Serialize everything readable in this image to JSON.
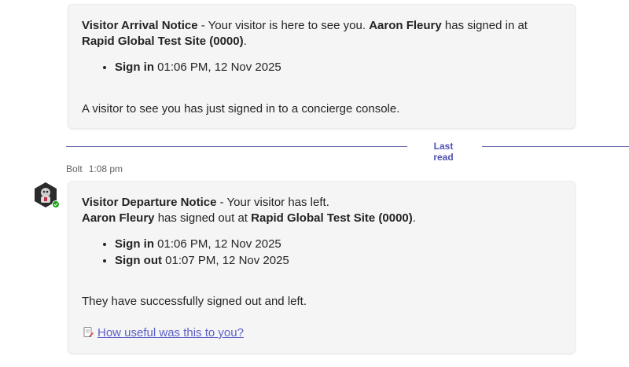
{
  "messages": [
    {
      "heading": "Visitor Arrival Notice",
      "sep": " - ",
      "intro": "Your visitor is here to see you.",
      "visitor": "Aaron Fleury",
      "action_text": "has signed in at",
      "site": "Rapid Global Test Site (0000)",
      "period": ".",
      "items": [
        {
          "label": "Sign in",
          "value": "01:06 PM, 12 Nov 2025"
        }
      ],
      "footer": "A visitor to see you has just signed in to a concierge console."
    },
    {
      "sender": "Bolt",
      "time": "1:08 pm",
      "heading": "Visitor Departure Notice",
      "sep": " - ",
      "intro": "Your visitor has left.",
      "visitor": "Aaron Fleury",
      "action_text": "has signed out at",
      "site": "Rapid Global Test Site (0000)",
      "period": ".",
      "items": [
        {
          "label": "Sign in",
          "value": "01:06 PM, 12 Nov 2025"
        },
        {
          "label": "Sign out",
          "value": "01:07 PM, 12 Nov 2025"
        }
      ],
      "footer": "They have successfully signed out and left.",
      "feedback_link": "How useful was this to you?",
      "feedback_icon": "memo-icon"
    }
  ],
  "divider": {
    "label": "Last read"
  },
  "colors": {
    "accent": "#5b5fc7",
    "divider": "#6264a7",
    "card_bg": "#f5f5f5",
    "presence": "#13a10e"
  }
}
